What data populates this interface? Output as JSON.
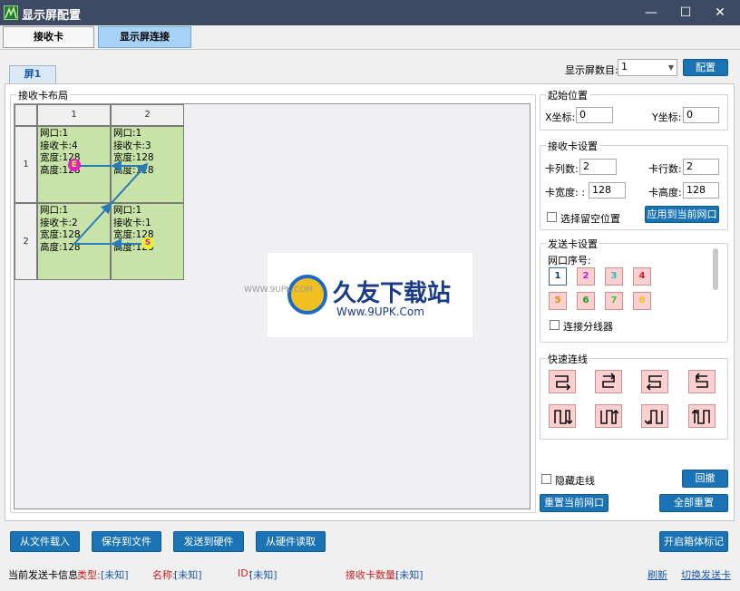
{
  "window": {
    "title": "显示屏配置",
    "minimize": "—",
    "maximize": "☐",
    "close": "✕"
  },
  "tabs": [
    {
      "label": "接收卡"
    },
    {
      "label": "显示屏连接"
    }
  ],
  "screen_tab": "屏1",
  "screen_count": {
    "label": "显示屏数目:",
    "value": "1",
    "config_button": "配置"
  },
  "layout": {
    "group_title": "接收卡布局",
    "col_headers": [
      "1",
      "2"
    ],
    "row_headers": [
      "1",
      "2"
    ],
    "cells": [
      [
        "网口:1",
        "接收卡:4",
        "宽度:128",
        "高度:128"
      ],
      [
        "网口:1",
        "接收卡:3",
        "宽度:128",
        "高度:128"
      ],
      [
        "网口:1",
        "接收卡:2",
        "宽度:128",
        "高度:128"
      ],
      [
        "网口:1",
        "接收卡:1",
        "宽度:128",
        "高度:128"
      ]
    ],
    "start_marker": "S",
    "end_marker": "E"
  },
  "watermark": {
    "text": "久友下载站",
    "url": "Www.9UPK.Com",
    "prefix": "WWW.9UPK.COM"
  },
  "start_position": {
    "title": "起始位置",
    "x_label": "X坐标:",
    "x_value": "0",
    "y_label": "Y坐标:",
    "y_value": "0"
  },
  "receiver_settings": {
    "title": "接收卡设置",
    "cols_label": "卡列数:",
    "cols_value": "2",
    "rows_label": "卡行数:",
    "rows_value": "2",
    "width_label": "卡宽度: :",
    "width_value": "128",
    "height_label": "卡高度:",
    "height_value": "128",
    "reserve_label": "选择留空位置",
    "apply_button": "应用到当前网口"
  },
  "sender_settings": {
    "title": "发送卡设置",
    "port_label": "网口序号:",
    "ports": [
      "1",
      "2",
      "3",
      "4",
      "5",
      "6",
      "7",
      "8"
    ],
    "port_colors": [
      "#1a3a8a",
      "#d020d0",
      "#20c0c0",
      "#d02020",
      "#e08a00",
      "#1a9a1a",
      "#30d030",
      "#f0c020"
    ],
    "splitter_label": "连接分线器"
  },
  "quick_connect": {
    "title": "快速连线"
  },
  "hide_lines": {
    "label": "隐藏走线"
  },
  "buttons": {
    "undo": "回撤",
    "reset_current": "重置当前网口",
    "reset_all": "全部重置",
    "load_file": "从文件载入",
    "save_file": "保存到文件",
    "send_hw": "发送到硬件",
    "read_hw": "从硬件读取",
    "box_mark": "开启箱体标记"
  },
  "status": {
    "current_info": "当前发送卡信息",
    "type_label": "类型:",
    "type_value": "[未知]",
    "name_label": "名称:",
    "name_value": "[未知]",
    "id_label": "ID:",
    "id_value": "[未知]",
    "count_label": "接收卡数量:",
    "count_value": "[未知]",
    "refresh": "刷新",
    "switch": "切换发送卡"
  }
}
